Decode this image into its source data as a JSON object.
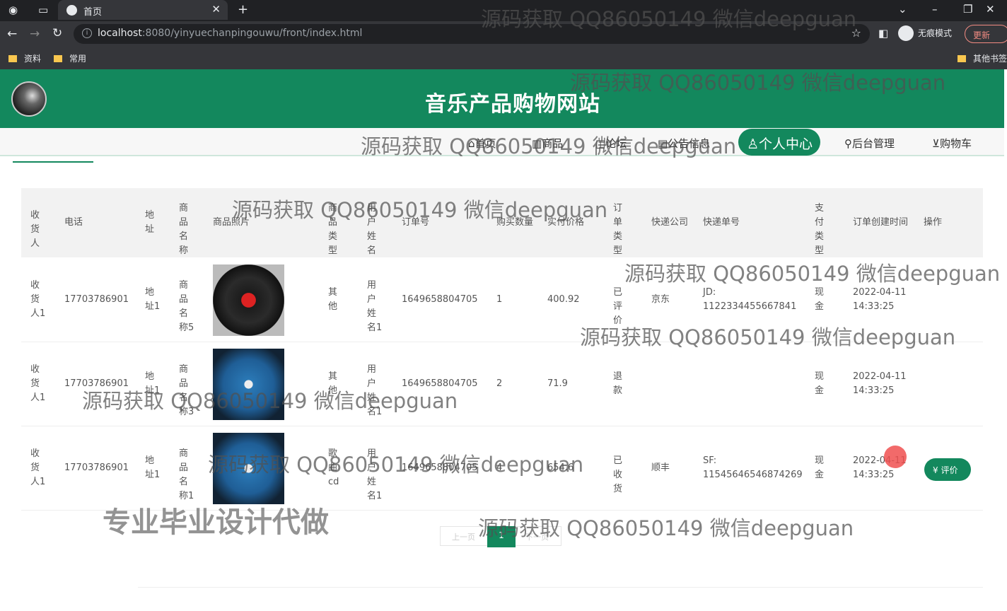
{
  "browser": {
    "tab_title": "首页",
    "url_host": "localhost",
    "url_path": ":8080/yinyuechanpingouwu/front/index.html",
    "incognito_label": "无痕模式",
    "update_label": "更新",
    "bookmarks": [
      "资料",
      "常用"
    ],
    "other_bookmarks": "其他书签"
  },
  "site": {
    "title": "音乐产品购物网站",
    "nav": [
      "首页",
      "商品",
      "论坛",
      "公告信息",
      "个人中心",
      "后台管理",
      "购物车"
    ],
    "nav_active": "个人中心"
  },
  "table": {
    "headers": [
      "收货人",
      "电话",
      "地址",
      "商品名称",
      "商品照片",
      "商品类型",
      "用户姓名",
      "订单号",
      "购买数量",
      "实付价格",
      "订单类型",
      "快递公司",
      "快递单号",
      "支付类型",
      "订单创建时间",
      "操作"
    ],
    "rows": [
      {
        "recipient": "收货人1",
        "phone": "17703786901",
        "address": "地址1",
        "product": "商品名称5",
        "photo": "vinyl",
        "type": "其他",
        "user": "用户姓名1",
        "order_no": "1649658804705",
        "qty": "1",
        "price": "400.92",
        "status": "已评价",
        "courier": "京东",
        "tracking": "JD: 1122334455667841",
        "pay": "现金",
        "created": "2022-04-11 14:33:25",
        "action": ""
      },
      {
        "recipient": "收货人1",
        "phone": "17703786901",
        "address": "地址1",
        "product": "商品名称3",
        "photo": "cd",
        "type": "其他",
        "user": "用户姓名1",
        "order_no": "1649658804705",
        "qty": "2",
        "price": "71.9",
        "status": "退款",
        "courier": "",
        "tracking": "",
        "pay": "现金",
        "created": "2022-04-11 14:33:25",
        "action": ""
      },
      {
        "recipient": "收货人1",
        "phone": "17703786901",
        "address": "地址1",
        "product": "商品名称1",
        "photo": "cd",
        "type": "歌曲cd",
        "user": "用户姓名1",
        "order_no": "1649658804705",
        "qty": "4",
        "price": "654.6",
        "status": "已收货",
        "courier": "顺丰",
        "tracking": "SF: 11545646546874269",
        "pay": "现金",
        "created": "2022-04-11 14:33:25",
        "action": "评价"
      }
    ]
  },
  "pager": {
    "prev": "上一页",
    "current": "1",
    "next": "下一页"
  },
  "overlays": {
    "watermark": "源码获取 QQ86050149 微信deepguan",
    "promo": "专业毕业设计代做"
  },
  "colors": {
    "brand": "#13885d"
  }
}
